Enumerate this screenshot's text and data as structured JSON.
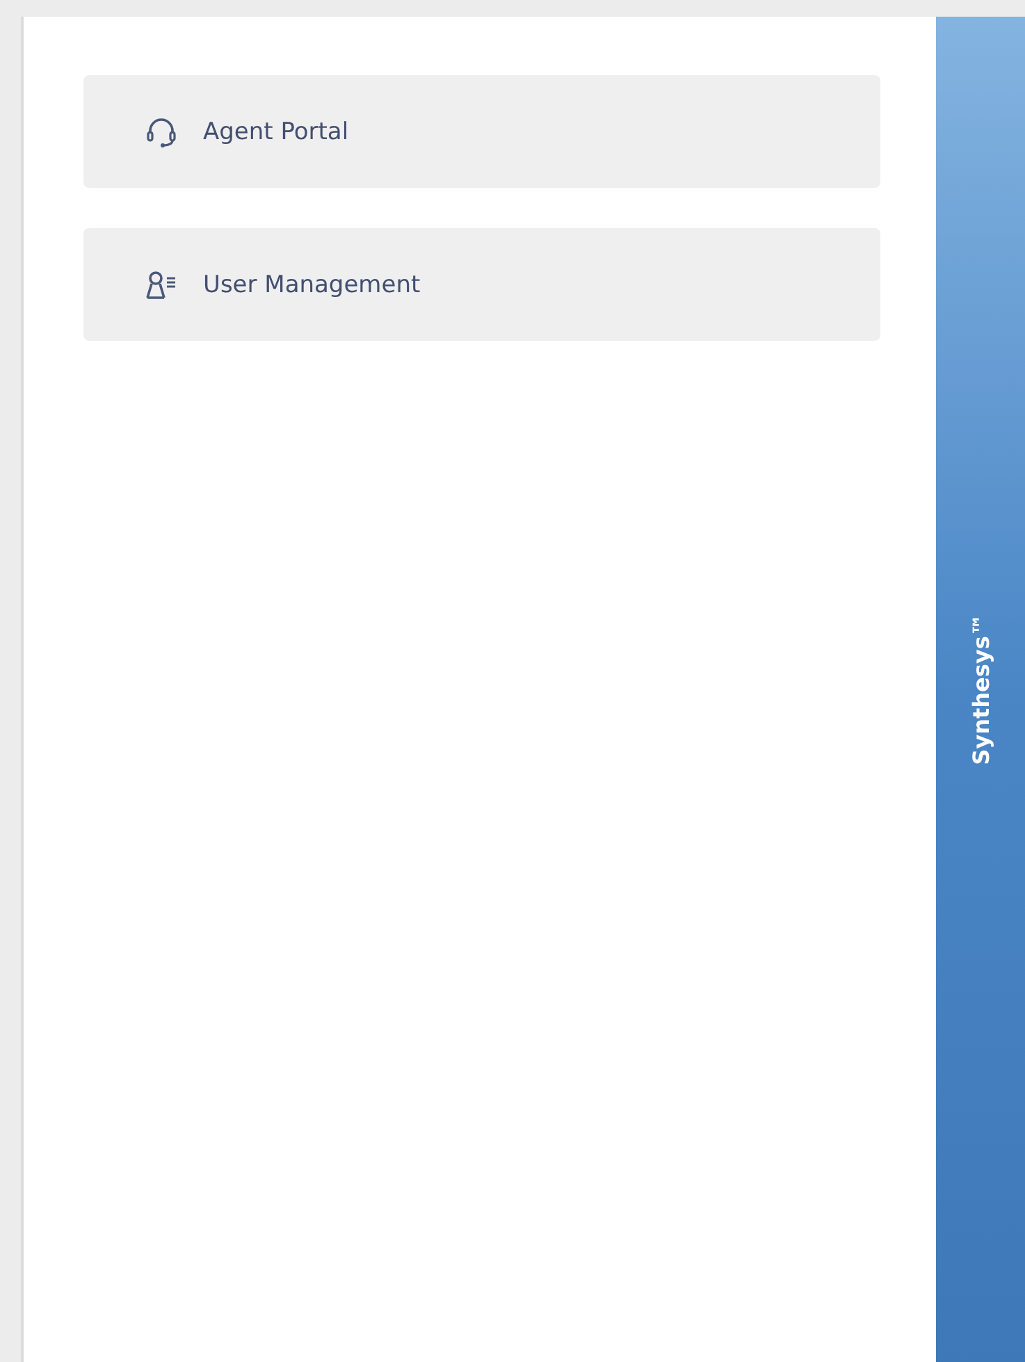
{
  "menu": [
    {
      "kind": "headset",
      "label": "Agent Portal"
    },
    {
      "kind": "users",
      "label": "User Management"
    }
  ],
  "brand_bar": {
    "text": "Synthesys™"
  }
}
